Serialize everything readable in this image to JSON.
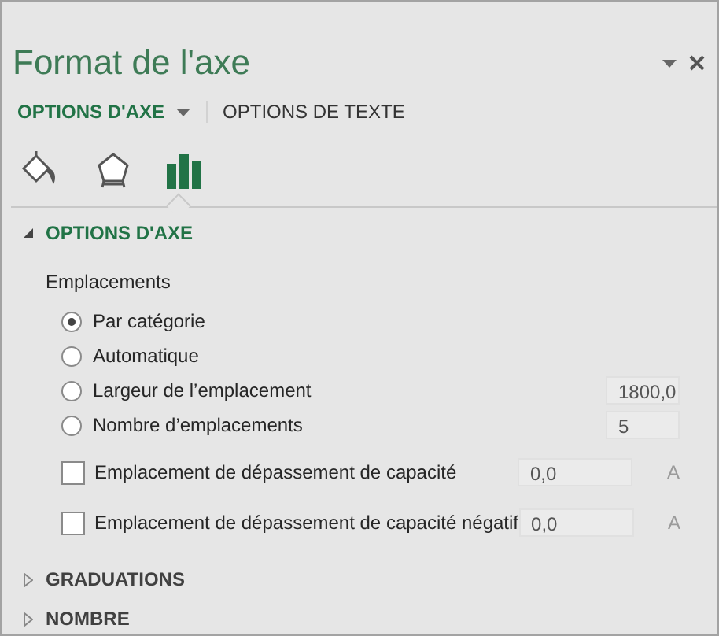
{
  "pane": {
    "title": "Format de l'axe"
  },
  "tabs": [
    {
      "label": "OPTIONS D'AXE",
      "selected": true,
      "dropdown": true
    },
    {
      "label": "OPTIONS DE TEXTE",
      "selected": false,
      "dropdown": false
    }
  ],
  "icon_tabs": [
    {
      "kind": "fill",
      "selected": false
    },
    {
      "kind": "effects",
      "selected": false
    },
    {
      "kind": "chart",
      "selected": true
    }
  ],
  "sections": [
    {
      "title": "OPTIONS D'AXE",
      "expanded": true,
      "heading": "Emplacements",
      "options": [
        {
          "kind": "radio",
          "label": "Par catégorie",
          "selected": true
        },
        {
          "kind": "radio",
          "label": "Automatique",
          "selected": false
        },
        {
          "kind": "radio",
          "label": "Largeur de l’emplacement",
          "selected": false,
          "value": "1800,0",
          "disabled": true
        },
        {
          "kind": "radio",
          "label": "Nombre d’emplacements",
          "selected": false,
          "value": "5",
          "disabled": true
        },
        {
          "kind": "checkbox",
          "label": "Emplacement de dépassement de capacité",
          "checked": false,
          "value": "0,0",
          "disabled": true,
          "unit": "A"
        },
        {
          "kind": "checkbox",
          "label": "Emplacement de dépassement de capacité négatif",
          "checked": false,
          "value": "0,0",
          "disabled": true,
          "unit": "A"
        }
      ]
    },
    {
      "title": "GRADUATIONS",
      "expanded": false
    },
    {
      "title": "NOMBRE",
      "expanded": false
    }
  ]
}
